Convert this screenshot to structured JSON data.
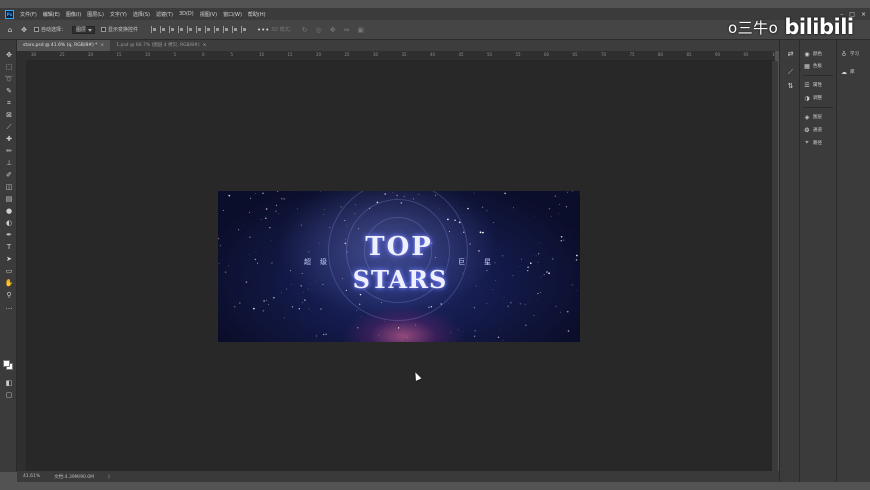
{
  "app": {
    "logo": "Ps"
  },
  "menu": [
    "文件(F)",
    "编辑(E)",
    "图像(I)",
    "图层(L)",
    "文字(Y)",
    "选择(S)",
    "滤镜(T)",
    "3D(D)",
    "视图(V)",
    "窗口(W)",
    "帮助(H)"
  ],
  "window_controls": [
    "–",
    "□",
    "×"
  ],
  "options": {
    "auto_select_label": "自动选择：",
    "auto_select_value": "图层",
    "show_transform_label": "显示变换控件",
    "mode_label": "3D 模式："
  },
  "tabs": [
    {
      "label": "stars.psd @ 41.6% (q, RGB/8#) *",
      "close": "×"
    },
    {
      "label": "1.psd @ 66.7% (图层 4 拷贝, RGB/8#)",
      "close": "×"
    }
  ],
  "ruler_top_labels": [
    "30",
    "25",
    "20",
    "15",
    "10",
    "5",
    "0",
    "5",
    "10",
    "15",
    "20",
    "25",
    "30",
    "35",
    "40",
    "45",
    "50",
    "55",
    "60",
    "65",
    "70",
    "75",
    "80",
    "85",
    "90",
    "95",
    "100"
  ],
  "artwork": {
    "title_line1": "TOP",
    "title_line2": "STARS",
    "sub_left_1": "超",
    "sub_left_2": "级",
    "sub_right_1": "巨",
    "sub_right_2": "星"
  },
  "status": {
    "zoom": "41.61%",
    "doc": "文档:4.39M/90.0M",
    "arrow": "〉"
  },
  "dock": {
    "color": "颜色",
    "swatches": "色板",
    "properties": "属性",
    "adjustments": "调整",
    "layers": "图层",
    "channels": "通道",
    "paths": "路径"
  },
  "dock2": {
    "learn": "学习",
    "libraries": "库"
  },
  "watermark": {
    "user": "o三牛o",
    "site": "bilibili"
  },
  "colors": {
    "foreground": "#ffffff",
    "background": "#ffffff",
    "accent": "#31a8ff"
  }
}
